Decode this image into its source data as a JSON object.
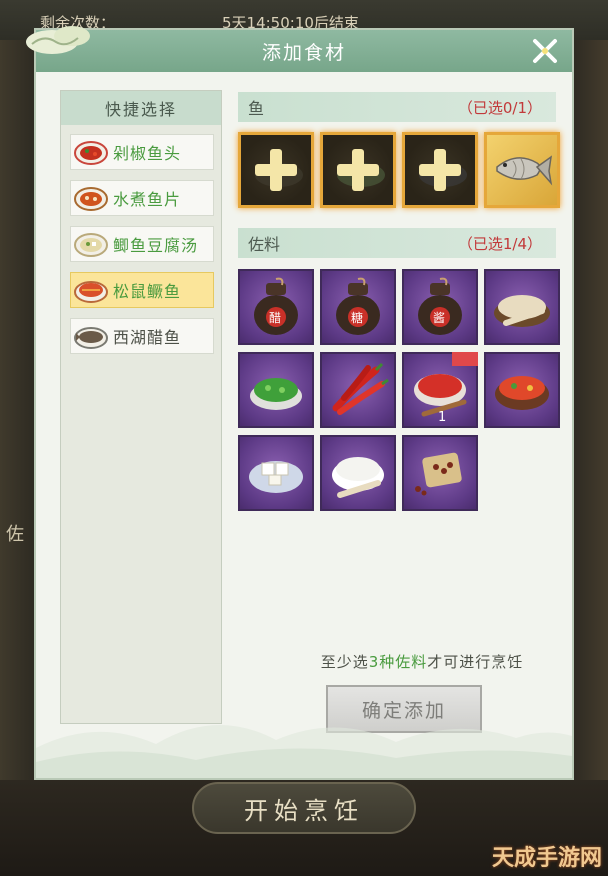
{
  "background": {
    "top_left_text": "剩余次数：",
    "top_timer": "5天14:50:10后结束",
    "side_char": "佐",
    "start_button": "开始烹饪",
    "watermark": "天成手游网"
  },
  "dialog": {
    "title": "添加食材",
    "quick_select": {
      "header": "快捷选择",
      "recipes": [
        {
          "label": "剁椒鱼头",
          "icon": "chili-fish-head-dish-icon",
          "active": false
        },
        {
          "label": "水煮鱼片",
          "icon": "boiled-fish-dish-icon",
          "active": false
        },
        {
          "label": "鲫鱼豆腐汤",
          "icon": "fish-tofu-soup-icon",
          "active": false
        },
        {
          "label": "松鼠鳜鱼",
          "icon": "squirrel-fish-dish-icon",
          "active": true
        },
        {
          "label": "西湖醋鱼",
          "icon": "west-lake-fish-dish-icon",
          "active": false
        }
      ]
    },
    "fish_section": {
      "title": "鱼",
      "count": "（已选0/1）",
      "items": [
        {
          "icon": "add-fish-slot-icon"
        },
        {
          "icon": "add-fish-slot-icon"
        },
        {
          "icon": "add-fish-slot-icon"
        },
        {
          "icon": "fish-icon"
        }
      ]
    },
    "seasoning_section": {
      "title": "佐料",
      "count": "（已选1/4）",
      "items": [
        {
          "icon": "vinegar-jar-icon",
          "jar_label": "醋"
        },
        {
          "icon": "sugar-jar-icon",
          "jar_label": "糖"
        },
        {
          "icon": "soy-sauce-jar-icon",
          "jar_label": "酱"
        },
        {
          "icon": "flour-bowl-icon"
        },
        {
          "icon": "scallion-bowl-icon"
        },
        {
          "icon": "red-chili-icon"
        },
        {
          "icon": "chili-sauce-bowl-icon",
          "quantity": "1"
        },
        {
          "icon": "chopped-chili-bowl-icon"
        },
        {
          "icon": "tofu-plate-icon"
        },
        {
          "icon": "starch-bowl-icon"
        },
        {
          "icon": "sichuan-pepper-icon"
        }
      ]
    },
    "hint": {
      "prefix": "至少选",
      "emphasis": "3种佐料",
      "suffix": "才可进行烹饪"
    },
    "confirm_button": "确定添加"
  },
  "colors": {
    "header_green": "#7fae92",
    "active_recipe": "#fbe59a",
    "selected_count_red": "#c2393a",
    "recipe_text_green": "#4a9b3f",
    "seasoning_tile_purple": "#6a4596",
    "fish_tile_border_gold": "#e5a73a"
  }
}
